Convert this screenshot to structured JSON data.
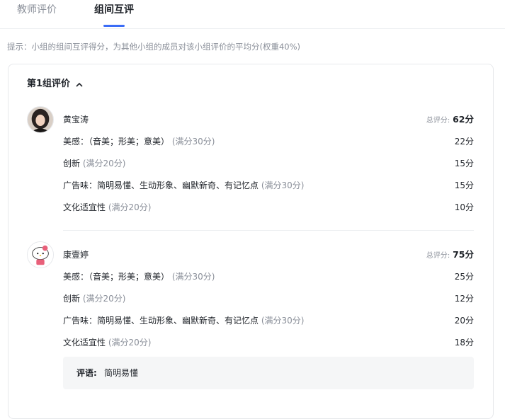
{
  "tabs": [
    {
      "label": "教师评价",
      "active": false
    },
    {
      "label": "组间互评",
      "active": true
    }
  ],
  "accent_color": "#3b6cf6",
  "hint": "提示：小组的组间互评得分，为其他小组的成员对该小组评价的平均分(权重40%)",
  "group": {
    "title": "第1组评价",
    "toggle_icon": "chevron-up-icon",
    "evaluations": [
      {
        "name": "黄宝涛",
        "total_label": "总评分:",
        "total_value": "62分",
        "criteria": [
          {
            "label": "美感：（音美；形美；意美）",
            "full": "(满分30分)",
            "score": "22分"
          },
          {
            "label": "创新",
            "full": "(满分20分)",
            "score": "15分"
          },
          {
            "label": "广告味：简明易懂、生动形象、幽默新奇、有记忆点",
            "full": "(满分30分)",
            "score": "15分"
          },
          {
            "label": "文化适宜性",
            "full": "(满分20分)",
            "score": "10分"
          }
        ]
      },
      {
        "name": "康壹婷",
        "total_label": "总评分:",
        "total_value": "75分",
        "criteria": [
          {
            "label": "美感：（音美；形美；意美）",
            "full": "(满分30分)",
            "score": "25分"
          },
          {
            "label": "创新",
            "full": "(满分20分)",
            "score": "12分"
          },
          {
            "label": "广告味：简明易懂、生动形象、幽默新奇、有记忆点",
            "full": "(满分30分)",
            "score": "20分"
          },
          {
            "label": "文化适宜性",
            "full": "(满分20分)",
            "score": "18分"
          }
        ],
        "comment_label": "评语:",
        "comment_text": "简明易懂"
      }
    ]
  }
}
